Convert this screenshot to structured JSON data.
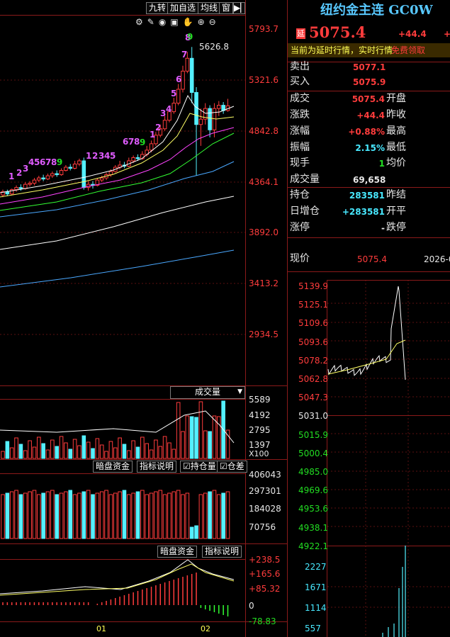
{
  "toolbar": {
    "buttons": [
      "九转",
      "加自选",
      "均线",
      "窗"
    ]
  },
  "symbol": {
    "title": "纽约金主连 GC0W",
    "delay_badge": "延",
    "price": "5075.4",
    "change": "+44.4",
    "change_pct": "+",
    "notice_prefix": "当前为延时行情，实时行情",
    "notice_link": "免费领取"
  },
  "quotes": {
    "sell_label": "卖出",
    "sell_value": "5077.1",
    "buy_label": "买入",
    "buy_value": "5075.9",
    "rows": [
      {
        "label": "成交",
        "value": "5075.4",
        "label2": "开盘",
        "color": "red"
      },
      {
        "label": "涨跌",
        "value": "+44.4",
        "label2": "昨收",
        "color": "red"
      },
      {
        "label": "涨幅",
        "value": "+0.88%",
        "label2": "最高",
        "color": "red"
      },
      {
        "label": "振幅",
        "value": "2.15%",
        "label2": "最低",
        "color": "cyan"
      },
      {
        "label": "现手",
        "value": "1",
        "label2": "均价",
        "color": "green"
      },
      {
        "label": "成交量",
        "value": "69,658",
        "label2": "",
        "color": "white"
      },
      {
        "label": "持仓",
        "value": "283581",
        "label2": "昨结",
        "color": "cyan"
      },
      {
        "label": "日增仓",
        "value": "+283581",
        "label2": "开平",
        "color": "cyan"
      },
      {
        "label": "涨停",
        "value": "-",
        "label2": "跌停",
        "color": "white"
      }
    ],
    "now_label": "现价",
    "now_value": "5075.4",
    "date_value": "2026-0"
  },
  "kline": {
    "axis_labels": [
      "5793.7",
      "5321.6",
      "4842.8",
      "4364.1",
      "3892.0",
      "3413.2",
      "2934.5"
    ],
    "high_label": "5626.8",
    "nine_counts": [
      {
        "t": "1",
        "c": "purple"
      },
      {
        "t": "2",
        "c": "purple"
      },
      {
        "t": "3",
        "c": "purple"
      },
      {
        "t": "4",
        "c": "purple"
      },
      {
        "t": "5",
        "c": "purple"
      },
      {
        "t": "6",
        "c": "purple"
      },
      {
        "t": "7",
        "c": "purple"
      },
      {
        "t": "8",
        "c": "purple"
      },
      {
        "t": "9",
        "c": "green"
      },
      {
        "t": "1",
        "c": "purple"
      },
      {
        "t": "2",
        "c": "purple"
      },
      {
        "t": "3",
        "c": "purple"
      },
      {
        "t": "4",
        "c": "purple"
      },
      {
        "t": "5",
        "c": "purple"
      },
      {
        "t": "6",
        "c": "purple"
      },
      {
        "t": "7",
        "c": "purple"
      },
      {
        "t": "8",
        "c": "purple"
      },
      {
        "t": "9",
        "c": "green"
      },
      {
        "t": "1",
        "c": "purple"
      },
      {
        "t": "2",
        "c": "purple"
      },
      {
        "t": "3",
        "c": "purple"
      },
      {
        "t": "4",
        "c": "purple"
      },
      {
        "t": "5",
        "c": "purple"
      },
      {
        "t": "6",
        "c": "purple"
      },
      {
        "t": "7",
        "c": "purple"
      },
      {
        "t": "8",
        "c": "purple"
      },
      {
        "t": "9",
        "c": "green"
      }
    ]
  },
  "volume": {
    "selector": "成交量",
    "axis_labels": [
      "5589",
      "4192",
      "2795",
      "1397"
    ],
    "unit": "X100"
  },
  "open_interest": {
    "buttons": [
      "暗盘资金",
      "指标说明"
    ],
    "checkboxes": [
      "持仓量",
      "仓差"
    ],
    "axis_labels": [
      "406043",
      "297301",
      "184028",
      "70756"
    ]
  },
  "macd": {
    "buttons": [
      "暗盘资金",
      "指标说明"
    ],
    "axis_labels": [
      "+238.5",
      "+165.6",
      "+85.32",
      "0",
      "-78.83"
    ]
  },
  "time_axis": [
    "01",
    "02"
  ],
  "intraday": {
    "price_labels": [
      "5139.9",
      "5125.1",
      "5109.6",
      "5093.6",
      "5078.2",
      "5062.8",
      "5047.3",
      "5031.0",
      "5015.9",
      "5000.4",
      "4985.0",
      "4969.6",
      "4953.6",
      "4938.1",
      "4922.1"
    ],
    "volume_labels": [
      "2227",
      "1671",
      "1114",
      "557"
    ]
  },
  "colors": {
    "up": "#ff3c3c",
    "down": "#54f0ff",
    "grid": "#8b1a1a",
    "ma_white": "#ffffff",
    "ma_yellow": "#ffff66",
    "ma_magenta": "#ff44ff",
    "ma_green": "#33ff33",
    "ma_blue": "#4aa8ff"
  }
}
